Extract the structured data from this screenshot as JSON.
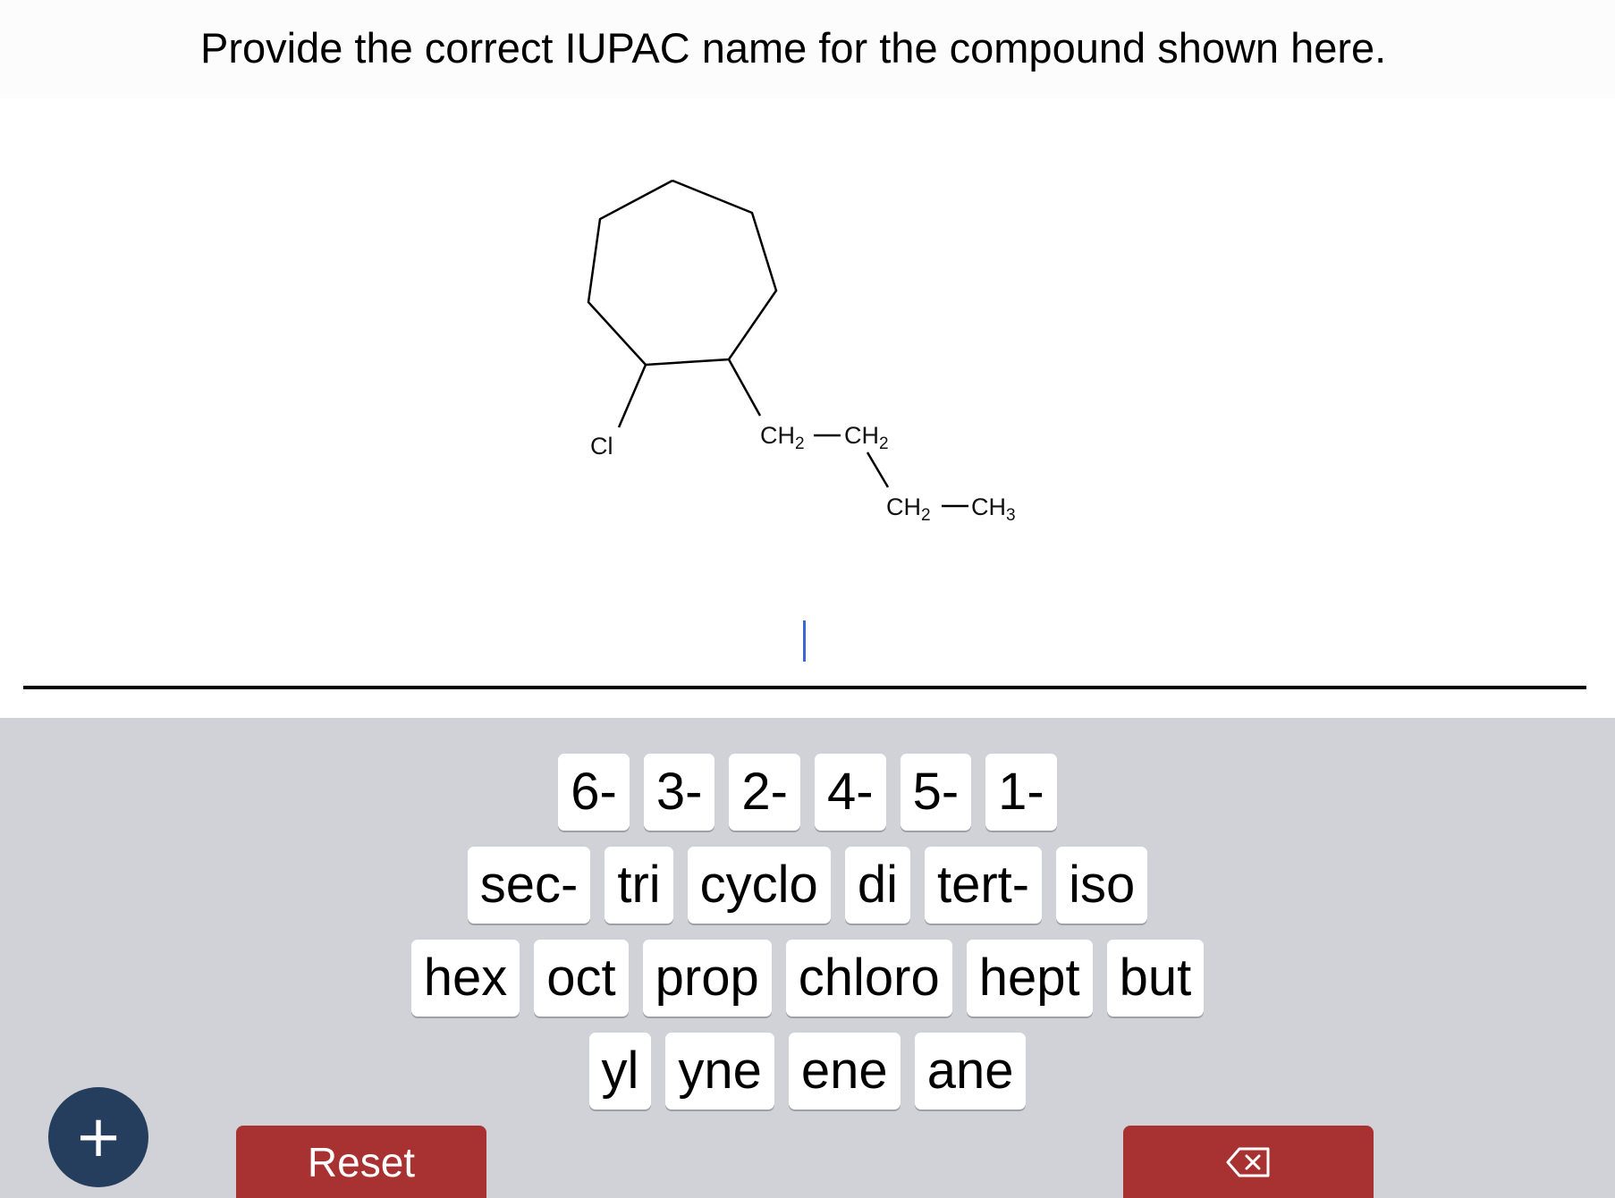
{
  "question": {
    "prompt": "Provide the correct IUPAC name for the compound shown here."
  },
  "structure": {
    "substituent": "Cl",
    "chain": [
      {
        "base": "CH",
        "sub": "2"
      },
      {
        "base": "CH",
        "sub": "2"
      },
      {
        "base": "CH",
        "sub": "2"
      },
      {
        "base": "CH",
        "sub": "3"
      }
    ]
  },
  "keyboard": {
    "row1": [
      "6-",
      "3-",
      "2-",
      "4-",
      "5-",
      "1-"
    ],
    "row2": [
      "sec-",
      "tri",
      "cyclo",
      "di",
      "tert-",
      "iso"
    ],
    "row3": [
      "hex",
      "oct",
      "prop",
      "chloro",
      "hept",
      "but"
    ],
    "row4": [
      "yl",
      "yne",
      "ene",
      "ane"
    ]
  },
  "controls": {
    "plus_label": "+",
    "reset_label": "Reset",
    "backspace_icon": "backspace-icon"
  },
  "colors": {
    "reset": "#a83131",
    "plus": "#263e5e",
    "cursor": "#3a66d6"
  }
}
